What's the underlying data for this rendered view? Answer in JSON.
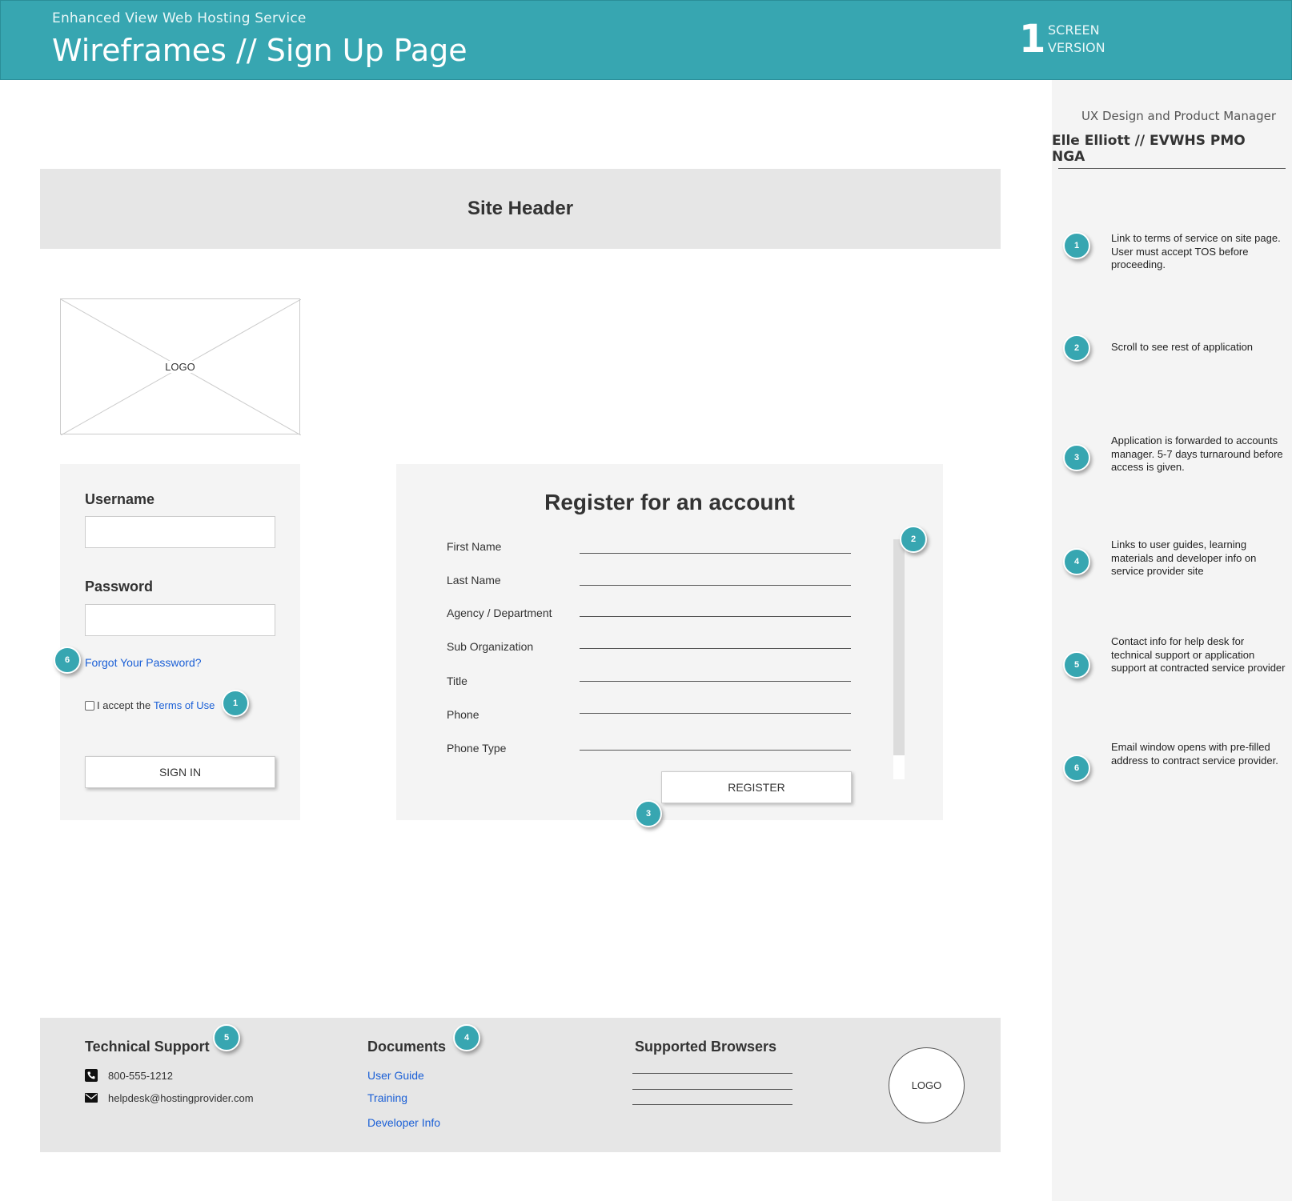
{
  "header": {
    "subtitle": "Enhanced View Web Hosting Service",
    "title": "Wireframes // Sign Up Page",
    "version_number": "1",
    "version_text_1": "SCREEN",
    "version_text_2": "VERSION"
  },
  "sidebar": {
    "role": "UX Design and Product Manager",
    "person": "Elle Elliott // EVWHS PMO NGA",
    "notes": [
      {
        "num": "1",
        "text": "Link to terms of service on site page. User must accept TOS before proceeding."
      },
      {
        "num": "2",
        "text": "Scroll to see rest of application"
      },
      {
        "num": "3",
        "text": "Application is forwarded to accounts manager. 5-7 days turnaround before access is given."
      },
      {
        "num": "4",
        "text": "Links to user guides, learning materials and developer info on service provider site"
      },
      {
        "num": "5",
        "text": "Contact info for help desk for technical support or application support at contracted service provider"
      },
      {
        "num": "6",
        "text": "Email window opens with pre-filled address to contract service provider."
      }
    ]
  },
  "site_header": "Site Header",
  "logo_placeholder": "LOGO",
  "login": {
    "username_label": "Username",
    "password_label": "Password",
    "forgot_link": "Forgot Your Password?",
    "tos_prefix": "I accept the ",
    "tos_link": "Terms of Use",
    "sign_in": "SIGN IN"
  },
  "register": {
    "title": "Register for an account",
    "fields": [
      "First Name",
      "Last Name",
      "Agency / Department",
      "Sub Organization",
      "Title",
      "Phone",
      "Phone Type"
    ],
    "button": "REGISTER"
  },
  "footer": {
    "support_title": "Technical Support",
    "phone": "800-555-1212",
    "email": "helpdesk@hostingprovider.com",
    "docs_title": "Documents",
    "docs": [
      "User Guide",
      "Training",
      "Developer Info"
    ],
    "browsers_title": "Supported Browsers",
    "logo": "LOGO"
  },
  "badges": {
    "b1": "1",
    "b2": "2",
    "b3": "3",
    "b4": "4",
    "b5": "5",
    "b6": "6"
  },
  "colors": {
    "accent": "#37a6b1",
    "link": "#1a5fd6",
    "panel": "#f4f4f4",
    "header_gray": "#e6e6e6"
  }
}
